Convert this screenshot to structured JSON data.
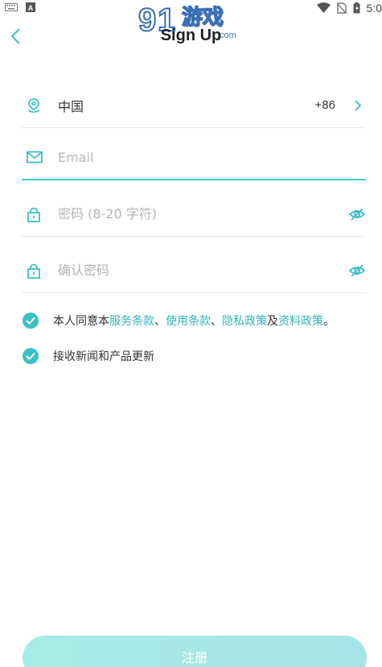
{
  "status_bar": {
    "time": "5:0"
  },
  "watermark": {
    "brand_number": "9",
    "brand_text": "游戏",
    "brand_domain": ".com"
  },
  "header": {
    "title": "Sign Up"
  },
  "region": {
    "country": "中国",
    "dial_code": "+86"
  },
  "email": {
    "placeholder": "Email"
  },
  "password": {
    "placeholder": "密码 (8-20 字符)"
  },
  "confirm_password": {
    "placeholder": "确认密码"
  },
  "agreement": {
    "prefix": "本人同意本",
    "terms_service": "服务条款",
    "sep1": "、",
    "terms_use": "使用条款",
    "sep2": "、",
    "privacy": "隐私政策",
    "and": "及",
    "data_policy": "资料政策",
    "suffix": "。"
  },
  "newsletter": {
    "label": "接收新闻和产品更新"
  },
  "submit": {
    "label": "注册"
  },
  "colors": {
    "accent": "#3dbfc6",
    "link": "#2fb3ba",
    "button": "#a8ece7"
  }
}
